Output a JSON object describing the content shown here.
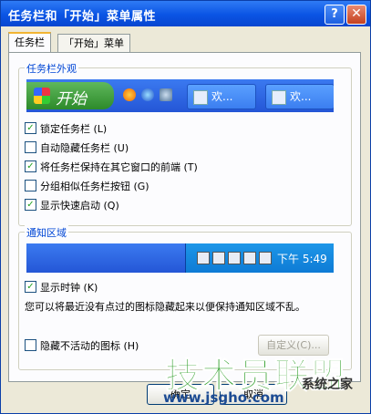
{
  "window": {
    "title": "任务栏和「开始」菜单属性",
    "help_label": "?",
    "close_label": "✕"
  },
  "tabs": [
    {
      "label": "任务栏",
      "active": true
    },
    {
      "label": "「开始」菜单",
      "active": false
    }
  ],
  "appearance": {
    "legend": "任务栏外观",
    "start_label": "开始",
    "taskbar_items": [
      "欢...",
      "欢..."
    ],
    "options": [
      {
        "label": "锁定任务栏 (L)",
        "checked": true
      },
      {
        "label": "自动隐藏任务栏 (U)",
        "checked": false
      },
      {
        "label": "将任务栏保持在其它窗口的前端 (T)",
        "checked": true
      },
      {
        "label": "分组相似任务栏按钮 (G)",
        "checked": false
      },
      {
        "label": "显示快速启动 (Q)",
        "checked": true
      }
    ]
  },
  "notification": {
    "legend": "通知区域",
    "clock": "下午 5:49",
    "show_clock": {
      "label": "显示时钟 (K)",
      "checked": true
    },
    "description": "您可以将最近没有点过的图标隐藏起来以便保持通知区域不乱。",
    "hide_inactive": {
      "label": "隐藏不活动的图标 (H)",
      "checked": false
    },
    "customize_label": "自定义(C)..."
  },
  "buttons": {
    "ok": "确定",
    "cancel": "取消"
  },
  "watermark": {
    "big": "技术员联盟",
    "site": "www.jsgho.com",
    "tag": "系统之家"
  },
  "colors": {
    "title_bar": "#0a54e4",
    "legend": "#0046d5",
    "checkmark": "#21a121"
  }
}
